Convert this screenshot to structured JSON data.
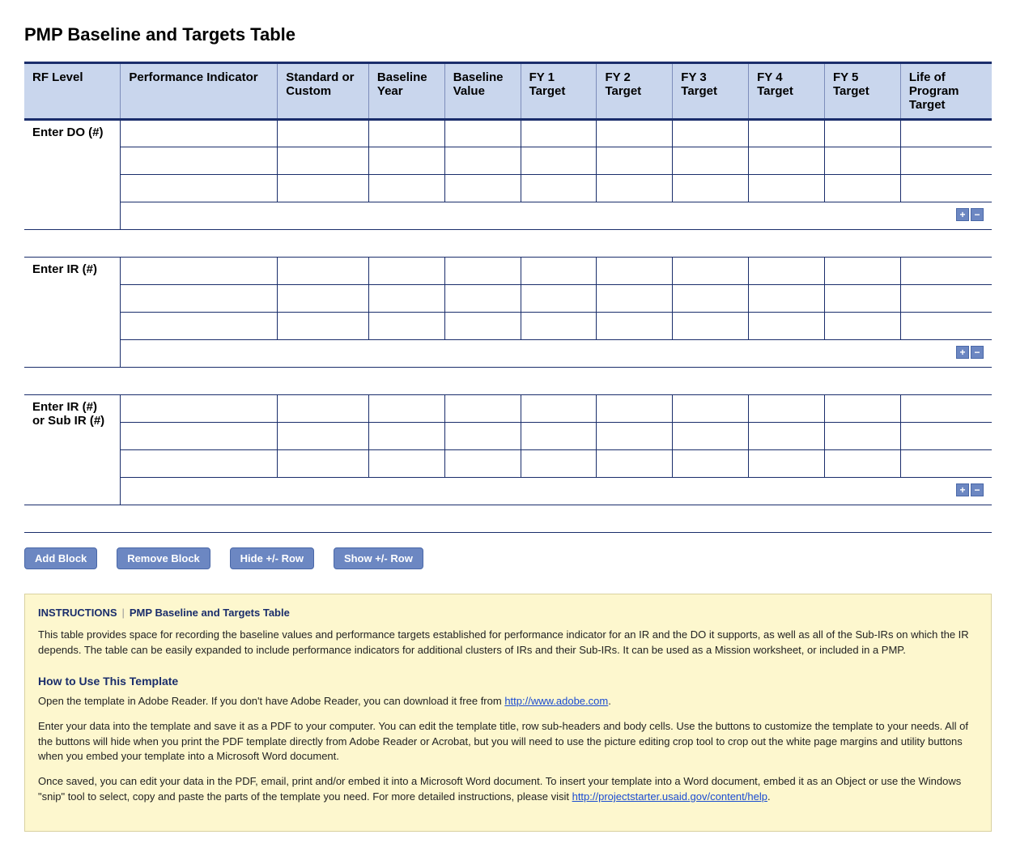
{
  "title": "PMP Baseline and Targets Table",
  "headers": {
    "rf": "RF Level",
    "pi": "Performance Indicator",
    "sc": "Standard or Custom",
    "by": "Baseline Year",
    "bv": "Baseline Value",
    "fy1": "FY 1 Target",
    "fy2": "FY 2 Target",
    "fy3": "FY 3 Target",
    "fy4": "FY 4 Target",
    "fy5": "FY 5 Target",
    "lp": "Life of Program Target"
  },
  "sections": [
    {
      "label": "Enter DO (#)"
    },
    {
      "label": "Enter IR (#)"
    },
    {
      "label": "Enter IR (#) or Sub IR (#)"
    }
  ],
  "mini": {
    "plus": "+",
    "minus": "−"
  },
  "buttons": {
    "add": "Add Block",
    "remove": "Remove Block",
    "hide": "Hide +/- Row",
    "show": "Show +/- Row"
  },
  "instr": {
    "label": "INSTRUCTIONS",
    "subtitle": "PMP Baseline and Targets Table",
    "p1": "This table provides space for recording the baseline values and performance targets established for performance indicator for an IR and the DO it supports, as well as all of the Sub-IRs on which the IR depends. The table can be easily expanded to include performance indicators for additional clusters of IRs and their Sub-IRs. It can be used as a Mission worksheet, or included in a PMP.",
    "h2": "How to Use This Template",
    "p2a": "Open the template in Adobe Reader. If you don't have Adobe Reader, you can download it free from ",
    "link1": "http://www.adobe.com",
    "p2b": ".",
    "p3": "Enter your data into the template and save it as a PDF to your computer. You can edit the template title, row sub-headers and body cells. Use the buttons to customize the template to your needs. All of the buttons will hide when you print the PDF template directly from Adobe Reader or Acrobat, but you will need to use the picture editing crop tool to crop out the white page margins and utility buttons when you embed your template into a Microsoft Word document.",
    "p4a": "Once saved, you can edit your data in the PDF, email, print and/or embed it into a Microsoft Word document. To insert your template into a Word document, embed it as an Object or use the Windows \"snip\" tool to select, copy and paste the parts of the template you need. For more detailed instructions, please visit ",
    "link2": "http://projectstarter.usaid.gov/content/help",
    "p4b": "."
  }
}
